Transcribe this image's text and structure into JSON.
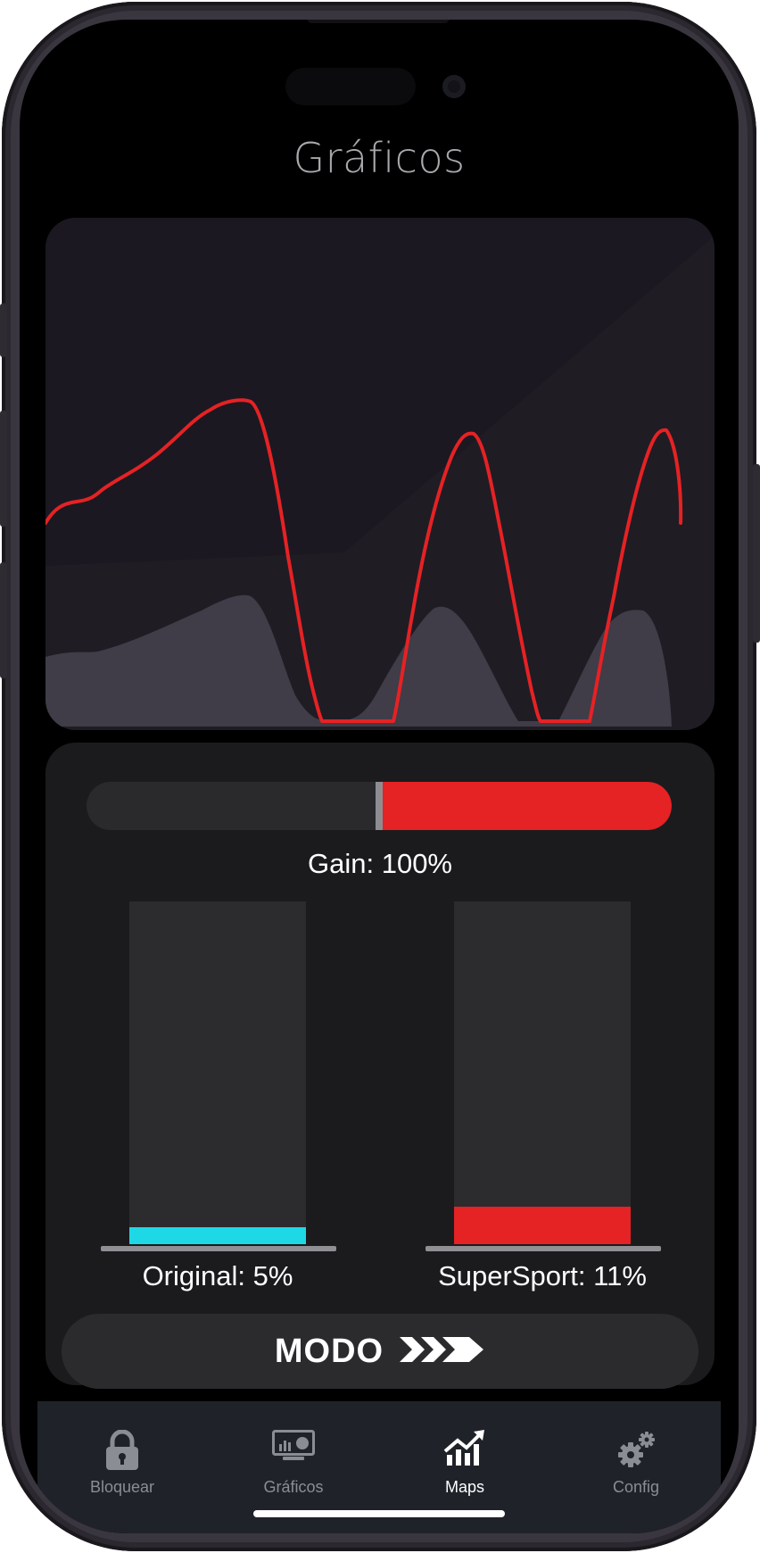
{
  "header": {
    "title": "Gráficos"
  },
  "gain": {
    "label": "Gain: 100%",
    "value_percent": 100,
    "slider_fraction": 0.5
  },
  "bars": [
    {
      "label": "Original: 5%",
      "fill_fraction": 0.05,
      "color": "#1ed8e6"
    },
    {
      "label": "SuperSport: 11%",
      "fill_fraction": 0.11,
      "color": "#e52224"
    }
  ],
  "mode_button": {
    "label": "MODO",
    "icon": "triple-chevron-right-icon"
  },
  "tabs": [
    {
      "label": "Bloquear",
      "icon": "lock-icon",
      "active": false
    },
    {
      "label": "Gráficos",
      "icon": "chart-panel-icon",
      "active": false
    },
    {
      "label": "Maps",
      "icon": "trend-up-icon",
      "active": true
    },
    {
      "label": "Config",
      "icon": "gears-icon",
      "active": false
    }
  ],
  "colors": {
    "accent": "#e52224",
    "cyan": "#1ed8e6",
    "background": "#000000",
    "card": "#1b1b1e",
    "tabbar": "#1f2329"
  }
}
